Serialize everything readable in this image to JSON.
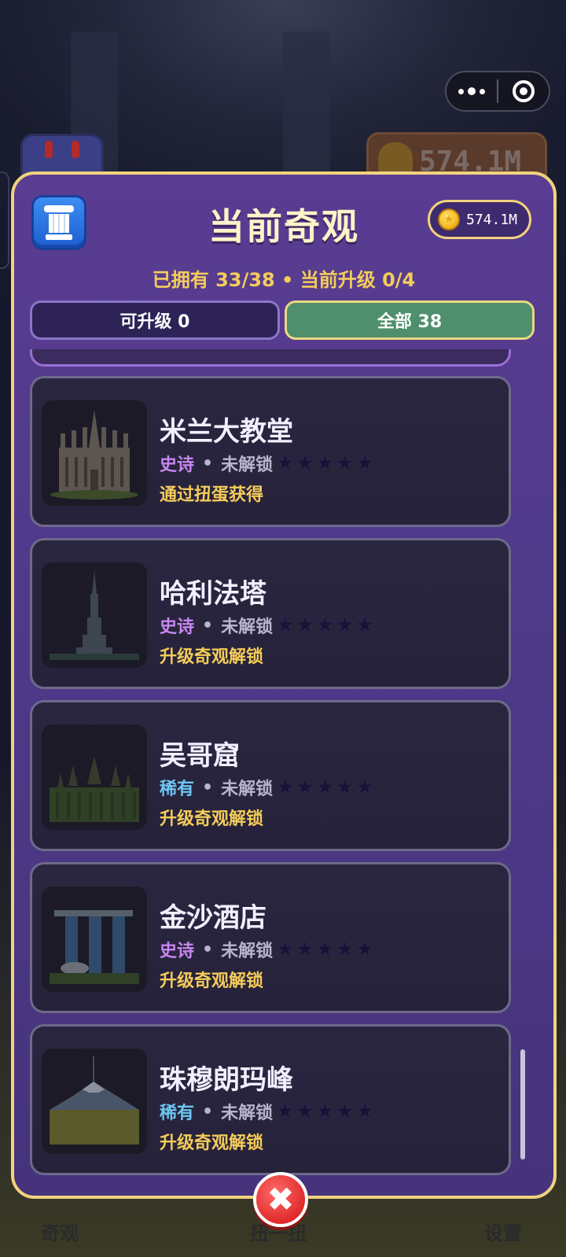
{
  "background": {
    "coins_display": "574.1M",
    "nav": {
      "left": "奇观",
      "center": "扭一扭",
      "right": "设置"
    }
  },
  "panel": {
    "title": "当前奇观",
    "coins": "574.1M",
    "summary": "已拥有 33/38 • 当前升级 0/4",
    "tabs": [
      {
        "label": "可升级 0",
        "selected": false
      },
      {
        "label": "全部 38",
        "selected": true
      }
    ],
    "wonders": [
      {
        "name": "米兰大教堂",
        "rarity": "史诗",
        "rarity_type": "epic",
        "status": "未解锁",
        "stars_filled": 0,
        "stars_total": 5,
        "source": "通过扭蛋获得"
      },
      {
        "name": "哈利法塔",
        "rarity": "史诗",
        "rarity_type": "epic",
        "status": "未解锁",
        "stars_filled": 0,
        "stars_total": 5,
        "source": "升级奇观解锁"
      },
      {
        "name": "吴哥窟",
        "rarity": "稀有",
        "rarity_type": "rare",
        "status": "未解锁",
        "stars_filled": 0,
        "stars_total": 5,
        "source": "升级奇观解锁"
      },
      {
        "name": "金沙酒店",
        "rarity": "史诗",
        "rarity_type": "epic",
        "status": "未解锁",
        "stars_filled": 0,
        "stars_total": 5,
        "source": "升级奇观解锁"
      },
      {
        "name": "珠穆朗玛峰",
        "rarity": "稀有",
        "rarity_type": "rare",
        "status": "未解锁",
        "stars_filled": 0,
        "stars_total": 5,
        "source": "升级奇观解锁"
      }
    ],
    "dot_separator": "•",
    "star_glyph": "★",
    "close_glyph": "✖"
  },
  "colors": {
    "epic": "#c687f0",
    "rare": "#6cc6f2",
    "gold": "#f4cc5a",
    "tab_selected": "#4f8f6d"
  },
  "icons": [
    "pillar-icon",
    "coin-icon",
    "more-icon",
    "capsule-close-icon",
    "close-icon",
    "star-icon"
  ]
}
